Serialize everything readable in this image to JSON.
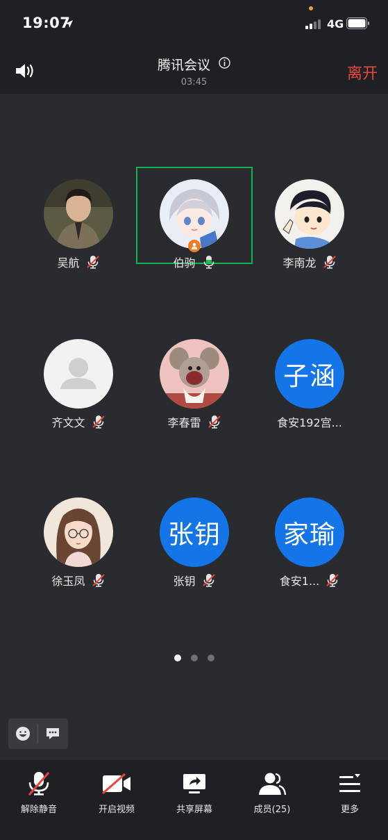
{
  "status_bar": {
    "time": "19:07",
    "network": "4G"
  },
  "header": {
    "title": "腾讯会议",
    "duration": "03:45",
    "leave_label": "离开"
  },
  "participants": [
    {
      "name": "吴航",
      "avatar": "photo-man",
      "mic": "muted"
    },
    {
      "name": "伯驹",
      "avatar": "anime-girl",
      "mic": "speaking",
      "active": true,
      "host": true
    },
    {
      "name": "李南龙",
      "avatar": "cartoon-boy",
      "mic": "muted"
    },
    {
      "name": "齐文文",
      "avatar": "default",
      "mic": "muted"
    },
    {
      "name": "李春雷",
      "avatar": "cartoon-mouse",
      "mic": "muted"
    },
    {
      "name": "食安192宫...",
      "avatar_text": "子涵",
      "mic": "muted"
    },
    {
      "name": "徐玉凤",
      "avatar": "illustrated-girl",
      "mic": "muted"
    },
    {
      "name": "张钥",
      "avatar_text": "张钥",
      "mic": "muted"
    },
    {
      "name": "食安1...",
      "avatar_text": "家瑜",
      "mic": "muted"
    }
  ],
  "pagination": {
    "pages": 3,
    "current": 1
  },
  "toolbar": {
    "unmute": "解除静音",
    "start_video": "开启视频",
    "share_screen": "共享屏幕",
    "members": "成员(25)",
    "more": "更多"
  },
  "colors": {
    "accent_blue": "#1475e8",
    "active_border": "#16b356",
    "leave_red": "#e8493f",
    "host_orange": "#f07c22"
  }
}
